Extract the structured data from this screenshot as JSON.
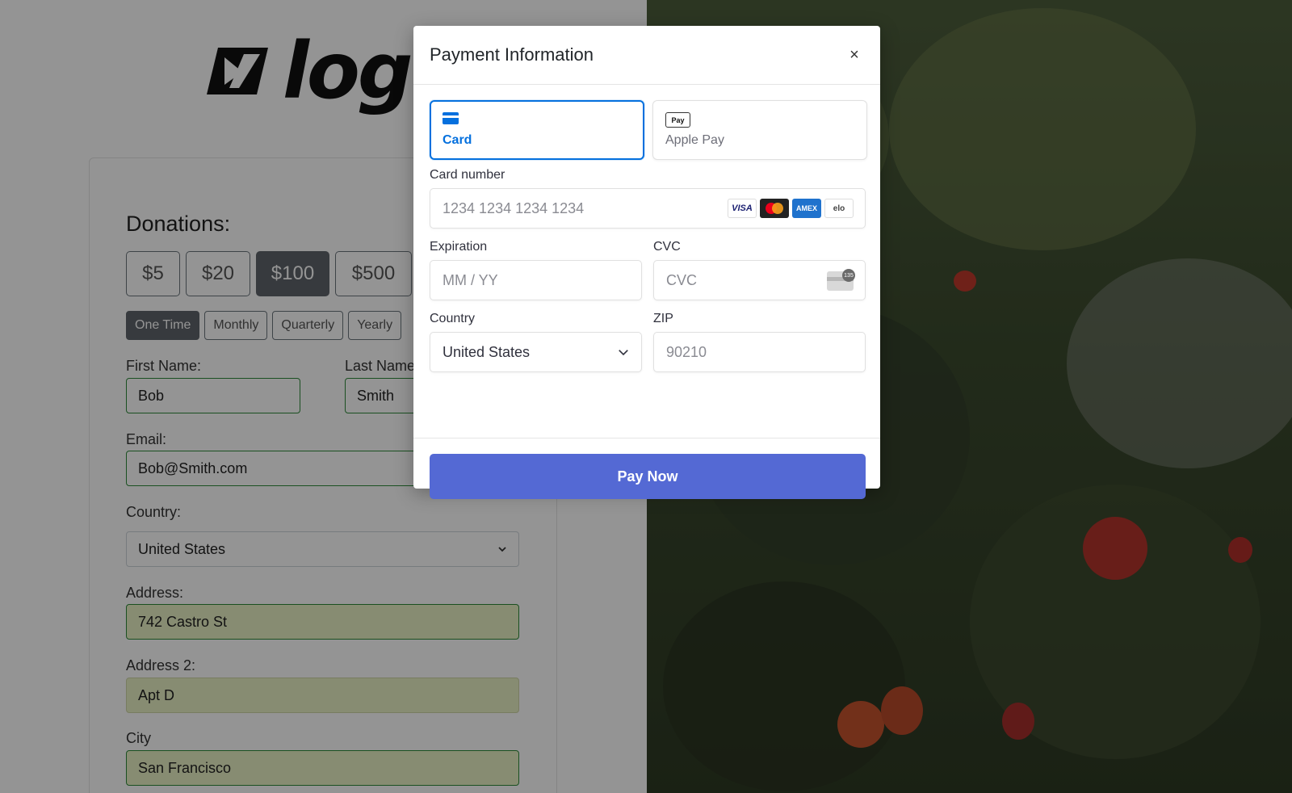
{
  "background_page": {
    "logo_text": "logo",
    "donations_title": "Donations:",
    "amounts": [
      "$5",
      "$20",
      "$100",
      "$500"
    ],
    "selected_amount": "$100",
    "frequencies": [
      "One Time",
      "Monthly",
      "Quarterly",
      "Yearly"
    ],
    "selected_frequency": "One Time",
    "first_name": {
      "label": "First Name:",
      "value": "Bob"
    },
    "last_name": {
      "label": "Last Name",
      "value": "Smith"
    },
    "email": {
      "label": "Email:",
      "value": "Bob@Smith.com"
    },
    "country": {
      "label": "Country:",
      "value": "United States"
    },
    "address": {
      "label": "Address:",
      "value": "742 Castro St"
    },
    "address2": {
      "label": "Address 2:",
      "value": "Apt D"
    },
    "city": {
      "label": "City",
      "value": "San Francisco"
    }
  },
  "modal": {
    "title": "Payment Information",
    "close_label": "×",
    "tabs": [
      {
        "label": "Card",
        "icon": "card-icon",
        "active": true
      },
      {
        "label": "Apple Pay",
        "icon": "apple-pay-icon",
        "active": false
      }
    ],
    "apple_pay_icon_text": "Pay",
    "card_number": {
      "label": "Card number",
      "placeholder": "1234 1234 1234 1234"
    },
    "card_brands": [
      "VISA",
      "mastercard",
      "AMEX",
      "elo"
    ],
    "expiration": {
      "label": "Expiration",
      "placeholder": "MM / YY"
    },
    "cvc": {
      "label": "CVC",
      "placeholder": "CVC",
      "icon_text": "135"
    },
    "country": {
      "label": "Country",
      "value": "United States"
    },
    "zip": {
      "label": "ZIP",
      "placeholder": "90210"
    },
    "pay_button": "Pay Now"
  },
  "colors": {
    "accent": "#0570de",
    "pay_button": "#5469d4",
    "valid_border": "#2e8b3a",
    "autofill_bg": "#e9f2c5"
  }
}
